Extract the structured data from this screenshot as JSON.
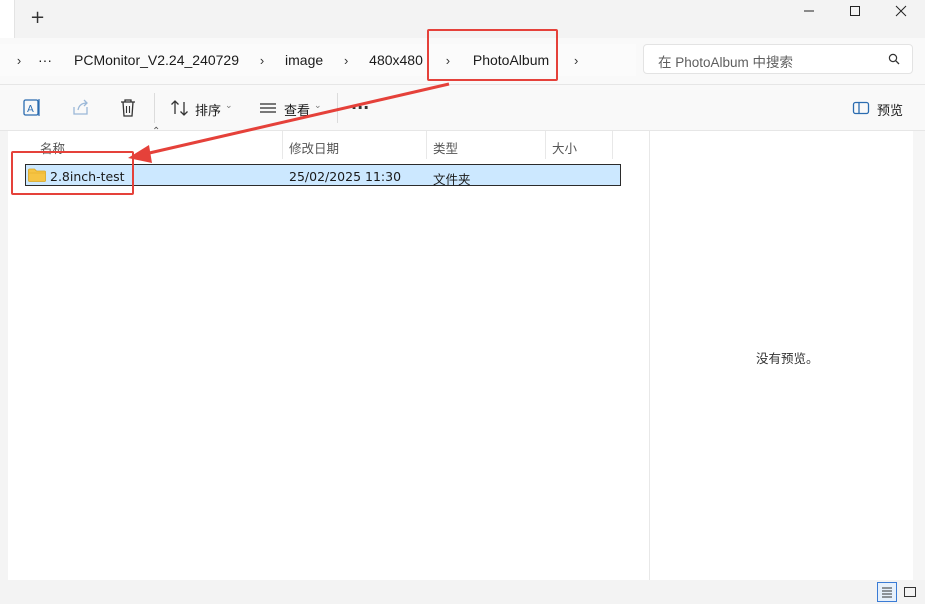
{
  "titlebar": {
    "new_tab_label": "+",
    "buttons": [
      "minimize-icon",
      "maximize-icon",
      "close-icon"
    ]
  },
  "breadcrumb": {
    "overflow_label": "···",
    "items": [
      "PCMonitor_V2.24_240729",
      "image",
      "480x480",
      "PhotoAlbum"
    ]
  },
  "search": {
    "placeholder": "在 PhotoAlbum 中搜索"
  },
  "toolbar": {
    "sort_label": "排序",
    "view_label": "查看",
    "more_label": "···",
    "preview_label": "预览"
  },
  "columns": {
    "name": "名称",
    "modified": "修改日期",
    "type": "类型",
    "size": "大小"
  },
  "files": [
    {
      "name": "2.8inch-test",
      "modified": "25/02/2025 11:30",
      "type": "文件夹",
      "size": ""
    }
  ],
  "preview": {
    "empty_text": "没有预览。"
  },
  "colors": {
    "selection": "#cce8ff",
    "annotation": "#e5413a",
    "folder": "#f6c443"
  }
}
